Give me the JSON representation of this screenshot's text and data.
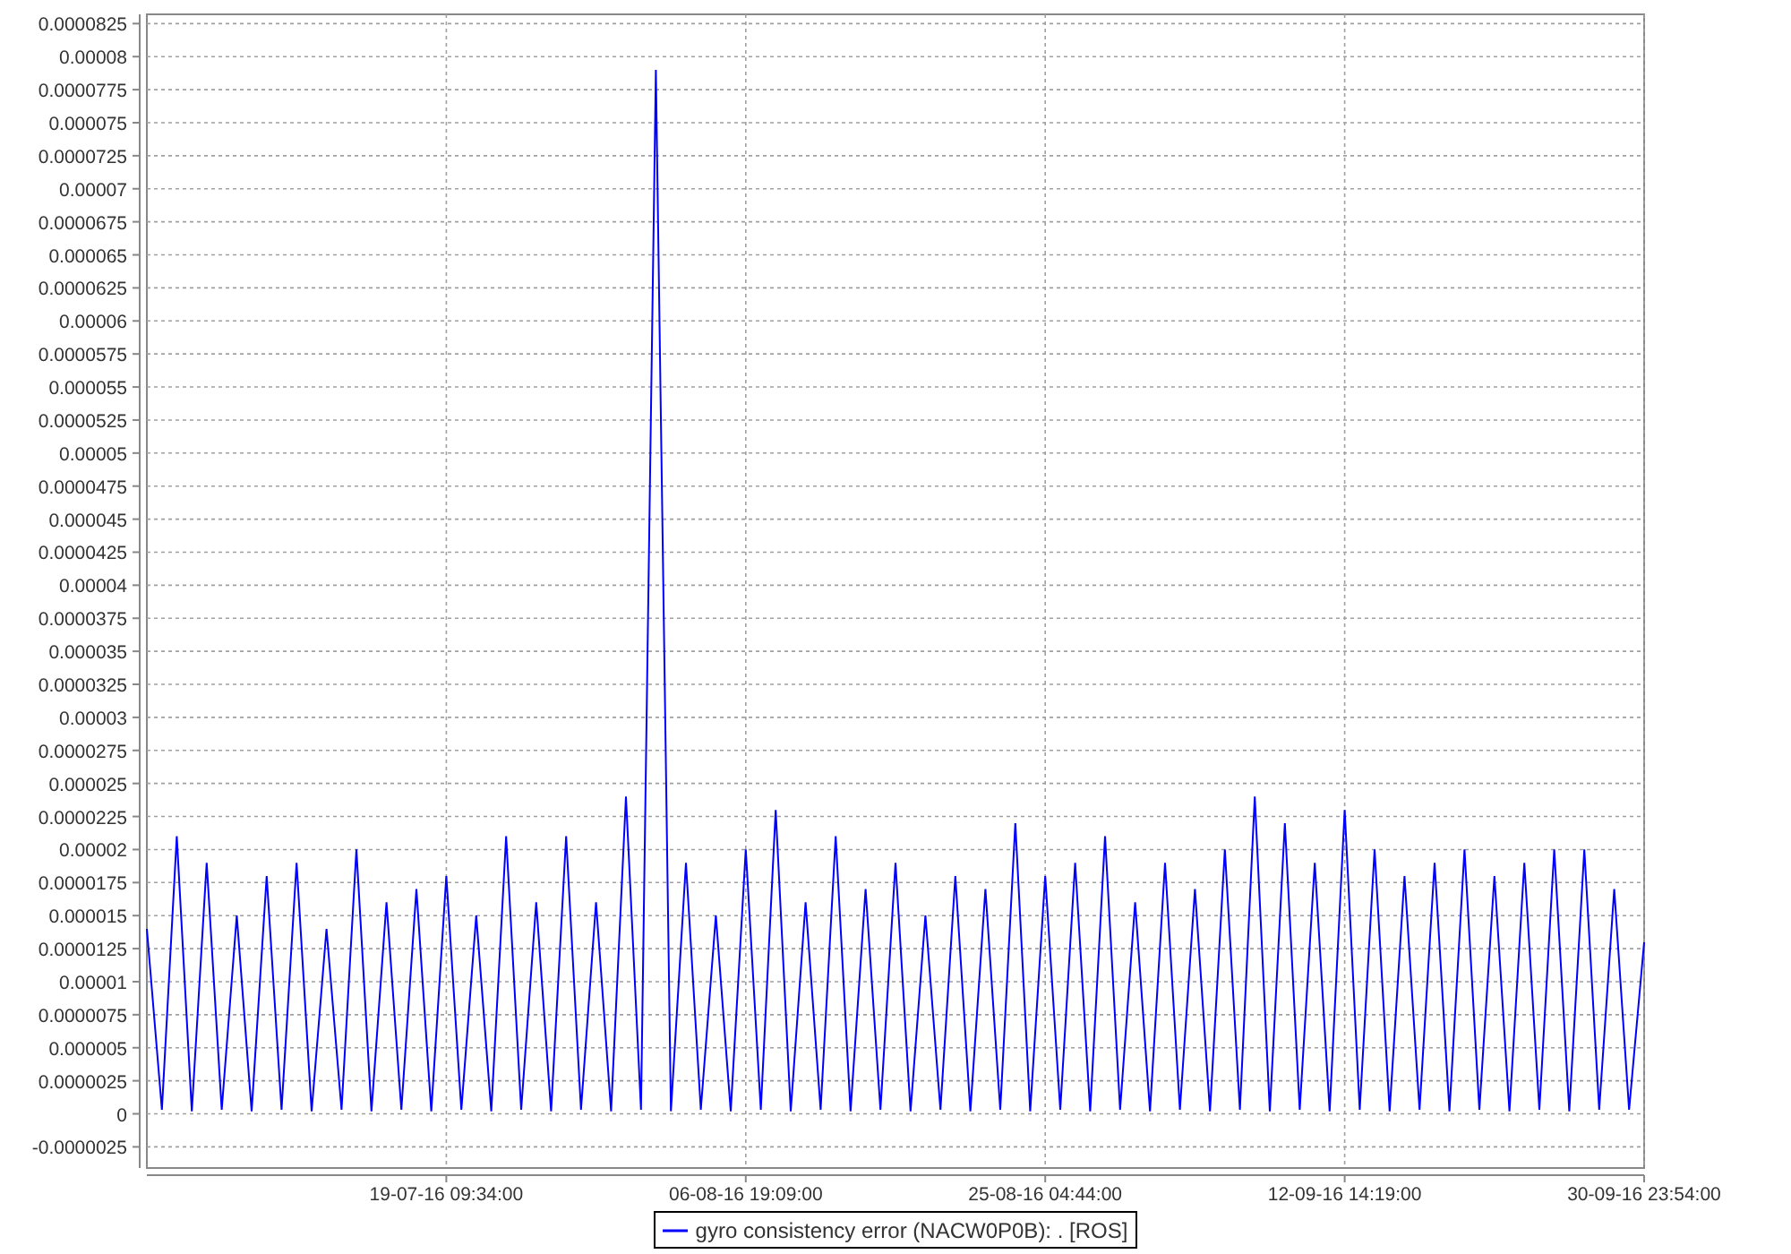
{
  "chart_data": {
    "type": "line",
    "categories": [
      null,
      null,
      null,
      null,
      null,
      null,
      null,
      null,
      null,
      null,
      null,
      null,
      null,
      null,
      null,
      null,
      null,
      null,
      null,
      null,
      "19-07-16 09:34:00",
      null,
      null,
      null,
      null,
      null,
      null,
      null,
      null,
      null,
      null,
      null,
      null,
      null,
      null,
      null,
      null,
      null,
      null,
      null,
      "06-08-16 19:09:00",
      null,
      null,
      null,
      null,
      null,
      null,
      null,
      null,
      null,
      null,
      null,
      null,
      null,
      null,
      null,
      null,
      null,
      null,
      null,
      "25-08-16 04:44:00",
      null,
      null,
      null,
      null,
      null,
      null,
      null,
      null,
      null,
      null,
      null,
      null,
      null,
      null,
      null,
      null,
      null,
      null,
      null,
      "12-09-16 14:19:00",
      null,
      null,
      null,
      null,
      null,
      null,
      null,
      null,
      null,
      null,
      null,
      null,
      null,
      null,
      null,
      null,
      null,
      null,
      null,
      "30-09-16 23:54:00"
    ],
    "series": [
      {
        "name": "gyro consistency error (NACW0P0B): . [ROS]",
        "color": "#0000ff",
        "values": [
          1.4e-05,
          3e-07,
          2.1e-05,
          2e-07,
          1.9e-05,
          3e-07,
          1.5e-05,
          2e-07,
          1.8e-05,
          3e-07,
          1.9e-05,
          2e-07,
          1.4e-05,
          3e-07,
          2e-05,
          2e-07,
          1.6e-05,
          3e-07,
          1.7e-05,
          2e-07,
          1.8e-05,
          3e-07,
          1.5e-05,
          2e-07,
          2.1e-05,
          3e-07,
          1.6e-05,
          2e-07,
          2.1e-05,
          3e-07,
          1.6e-05,
          2e-07,
          2.4e-05,
          3e-07,
          7.9e-05,
          2e-07,
          1.9e-05,
          3e-07,
          1.5e-05,
          2e-07,
          2e-05,
          3e-07,
          2.3e-05,
          2e-07,
          1.6e-05,
          3e-07,
          2.1e-05,
          2e-07,
          1.7e-05,
          3e-07,
          1.9e-05,
          2e-07,
          1.5e-05,
          3e-07,
          1.8e-05,
          2e-07,
          1.7e-05,
          3e-07,
          2.2e-05,
          2e-07,
          1.8e-05,
          3e-07,
          1.9e-05,
          2e-07,
          2.1e-05,
          3e-07,
          1.6e-05,
          2e-07,
          1.9e-05,
          3e-07,
          1.7e-05,
          2e-07,
          2e-05,
          3e-07,
          2.4e-05,
          2e-07,
          2.2e-05,
          3e-07,
          1.9e-05,
          2e-07,
          2.3e-05,
          3e-07,
          2e-05,
          2e-07,
          1.8e-05,
          3e-07,
          1.9e-05,
          2e-07,
          2e-05,
          3e-07,
          1.8e-05,
          2e-07,
          1.9e-05,
          3e-07,
          2e-05,
          2e-07,
          2e-05,
          3e-07,
          1.7e-05,
          3e-07,
          1.3e-05
        ]
      }
    ],
    "grid": true,
    "ylim": [
      -4.1e-06,
      8.32e-05
    ],
    "yticks": [
      {
        "value": -2.5e-06,
        "label": "-0.0000025"
      },
      {
        "value": 0,
        "label": "0"
      },
      {
        "value": 2.5e-06,
        "label": "0.0000025"
      },
      {
        "value": 5e-06,
        "label": "0.000005"
      },
      {
        "value": 7.5e-06,
        "label": "0.0000075"
      },
      {
        "value": 1e-05,
        "label": "0.00001"
      },
      {
        "value": 1.25e-05,
        "label": "0.0000125"
      },
      {
        "value": 1.5e-05,
        "label": "0.000015"
      },
      {
        "value": 1.75e-05,
        "label": "0.0000175"
      },
      {
        "value": 2e-05,
        "label": "0.00002"
      },
      {
        "value": 2.25e-05,
        "label": "0.0000225"
      },
      {
        "value": 2.5e-05,
        "label": "0.000025"
      },
      {
        "value": 2.75e-05,
        "label": "0.0000275"
      },
      {
        "value": 3e-05,
        "label": "0.00003"
      },
      {
        "value": 3.25e-05,
        "label": "0.0000325"
      },
      {
        "value": 3.5e-05,
        "label": "0.000035"
      },
      {
        "value": 3.75e-05,
        "label": "0.0000375"
      },
      {
        "value": 4e-05,
        "label": "0.00004"
      },
      {
        "value": 4.25e-05,
        "label": "0.0000425"
      },
      {
        "value": 4.5e-05,
        "label": "0.000045"
      },
      {
        "value": 4.75e-05,
        "label": "0.0000475"
      },
      {
        "value": 5e-05,
        "label": "0.00005"
      },
      {
        "value": 5.25e-05,
        "label": "0.0000525"
      },
      {
        "value": 5.5e-05,
        "label": "0.000055"
      },
      {
        "value": 5.75e-05,
        "label": "0.0000575"
      },
      {
        "value": 6e-05,
        "label": "0.00006"
      },
      {
        "value": 6.25e-05,
        "label": "0.0000625"
      },
      {
        "value": 6.5e-05,
        "label": "0.000065"
      },
      {
        "value": 6.75e-05,
        "label": "0.0000675"
      },
      {
        "value": 7e-05,
        "label": "0.00007"
      },
      {
        "value": 7.25e-05,
        "label": "0.0000725"
      },
      {
        "value": 7.5e-05,
        "label": "0.000075"
      },
      {
        "value": 7.75e-05,
        "label": "0.0000775"
      },
      {
        "value": 8e-05,
        "label": "0.00008"
      },
      {
        "value": 8.25e-05,
        "label": "0.0000825"
      }
    ]
  }
}
